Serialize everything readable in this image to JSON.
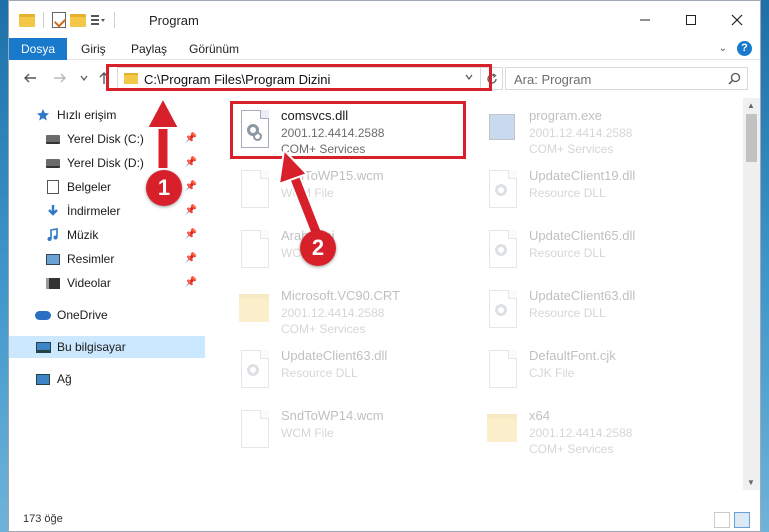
{
  "window": {
    "title": "Program"
  },
  "ribbon": {
    "tabs": [
      "Dosya",
      "Giriş",
      "Paylaş",
      "Görünüm"
    ],
    "help_label": "?"
  },
  "address": {
    "path": "C:\\Program Files\\Program Dizini",
    "search_placeholder": "Ara: Program"
  },
  "sidebar": {
    "items": [
      {
        "label": "Hızlı erişim",
        "icon": "star-icon"
      },
      {
        "label": "Yerel Disk (C:)",
        "icon": "drive-icon",
        "pinned": true
      },
      {
        "label": "Yerel Disk (D:)",
        "icon": "drive-icon",
        "pinned": true
      },
      {
        "label": "Belgeler",
        "icon": "documents-icon",
        "pinned": true
      },
      {
        "label": "İndirmeler",
        "icon": "downloads-icon",
        "pinned": true
      },
      {
        "label": "Müzik",
        "icon": "music-icon",
        "pinned": true
      },
      {
        "label": "Resimler",
        "icon": "pictures-icon",
        "pinned": true
      },
      {
        "label": "Videolar",
        "icon": "videos-icon",
        "pinned": true
      },
      {
        "label": "OneDrive",
        "icon": "cloud-icon"
      },
      {
        "label": "Bu bilgisayar",
        "icon": "computer-icon",
        "selected": true
      },
      {
        "label": "Ağ",
        "icon": "network-icon"
      }
    ]
  },
  "files": [
    {
      "name": "comsvcs.dll",
      "line2": "2001.12.4414.2588",
      "line3": "COM+ Services",
      "icon": "dll-icon",
      "highlighted": true
    },
    {
      "name": "program.exe",
      "line2": "2001.12.4414.2588",
      "line3": "COM+ Services",
      "icon": "exe-icon"
    },
    {
      "name": "SndToWP15.wcm",
      "line2": "WCM File",
      "line3": "",
      "icon": "file-icon"
    },
    {
      "name": "UpdateClient19.dll",
      "line2": "Resource DLL",
      "line3": "",
      "icon": "dll-icon"
    },
    {
      "name": "Arabic.ini",
      "line2": "WCM File",
      "line3": "",
      "icon": "file-icon"
    },
    {
      "name": "UpdateClient65.dll",
      "line2": "Resource DLL",
      "line3": "",
      "icon": "dll-icon"
    },
    {
      "name": "Microsoft.VC90.CRT",
      "line2": "2001.12.4414.2588",
      "line3": "COM+ Services",
      "icon": "folder-icon"
    },
    {
      "name": "UpdateClient63.dll",
      "line2": "Resource DLL",
      "line3": "",
      "icon": "dll-icon"
    },
    {
      "name": "UpdateClient63.dll",
      "line2": "Resource DLL",
      "line3": "",
      "icon": "dll-icon"
    },
    {
      "name": "DefaultFont.cjk",
      "line2": "CJK File",
      "line3": "",
      "icon": "file-icon"
    },
    {
      "name": "SndToWP14.wcm",
      "line2": "WCM File",
      "line3": "",
      "icon": "file-icon"
    },
    {
      "name": "x64",
      "line2": "2001.12.4414.2588",
      "line3": "COM+ Services",
      "icon": "folder-icon"
    }
  ],
  "status": {
    "item_count": "173 öğe"
  },
  "callouts": [
    "1",
    "2"
  ],
  "colors": {
    "accent": "#1979ca",
    "highlight": "#d8202b",
    "selection": "#cce8ff"
  }
}
